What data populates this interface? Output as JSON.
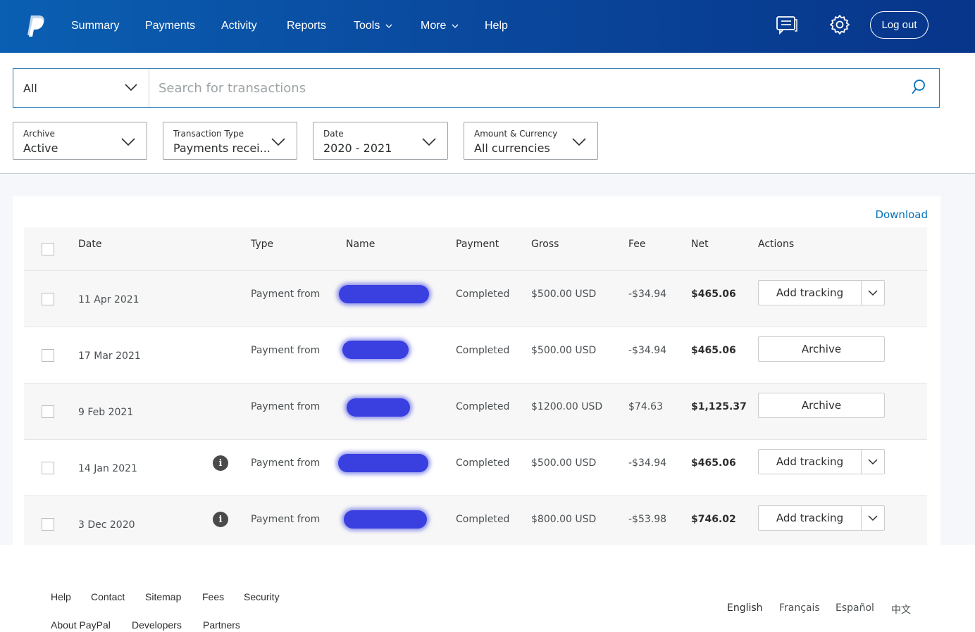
{
  "header": {
    "logo": "paypal-logo",
    "nav": [
      {
        "label": "Summary"
      },
      {
        "label": "Payments"
      },
      {
        "label": "Activity"
      },
      {
        "label": "Reports"
      },
      {
        "label": "Tools",
        "has_menu": true
      },
      {
        "label": "More",
        "has_menu": true
      },
      {
        "label": "Help"
      }
    ],
    "icons": [
      "message-center-icon",
      "gear-icon"
    ],
    "logout_label": "Log out"
  },
  "search": {
    "scope_value": "All",
    "placeholder": "Search for transactions",
    "value": ""
  },
  "filters": [
    {
      "label": "Archive",
      "value": "Active"
    },
    {
      "label": "Transaction Type",
      "value": "Payments recei..."
    },
    {
      "label": "Date",
      "value": "2020 - 2021"
    },
    {
      "label": "Amount & Currency",
      "value": "All currencies"
    }
  ],
  "table": {
    "download_label": "Download",
    "columns": [
      "Date",
      "Type",
      "Name",
      "Payment",
      "Gross",
      "Fee",
      "Net",
      "Actions"
    ],
    "rows": [
      {
        "date": "11 Apr 2021",
        "info": false,
        "type": "Payment from",
        "name_redacted": true,
        "payment": "Completed",
        "gross": "$500.00 USD",
        "fee": "-$34.94",
        "net": "$465.06",
        "action": "Add tracking",
        "action_split": true
      },
      {
        "date": "17 Mar 2021",
        "info": false,
        "type": "Payment from",
        "name_redacted": true,
        "payment": "Completed",
        "gross": "$500.00 USD",
        "fee": "-$34.94",
        "net": "$465.06",
        "action": "Archive",
        "action_split": false
      },
      {
        "date": "9 Feb 2021",
        "info": false,
        "type": "Payment from",
        "name_redacted": true,
        "payment": "Completed",
        "gross": "$1200.00 USD",
        "fee": "$74.63",
        "net": "$1,125.37",
        "action": "Archive",
        "action_split": false
      },
      {
        "date": "14 Jan 2021",
        "info": true,
        "type": "Payment from",
        "name_redacted": true,
        "payment": "Completed",
        "gross": "$500.00 USD",
        "fee": "-$34.94",
        "net": "$465.06",
        "action": "Add tracking",
        "action_split": true
      },
      {
        "date": "3 Dec 2020",
        "info": true,
        "type": "Payment from",
        "name_redacted": true,
        "payment": "Completed",
        "gross": "$800.00 USD",
        "fee": "-$53.98",
        "net": "$746.02",
        "action": "Add tracking",
        "action_split": true
      }
    ],
    "info_glyph": "i"
  },
  "footer": {
    "links_row1": [
      "Help",
      "Contact",
      "Sitemap",
      "Fees",
      "Security"
    ],
    "links_row2": [
      "About PayPal",
      "Developers",
      "Partners"
    ],
    "languages": [
      "English",
      "Français",
      "Español",
      "中文"
    ],
    "active_language": "English"
  },
  "colors": {
    "header_start": "#0a5fb2",
    "header_end": "#07358a",
    "link": "#0070ba",
    "redaction": "#3a3fe0"
  }
}
